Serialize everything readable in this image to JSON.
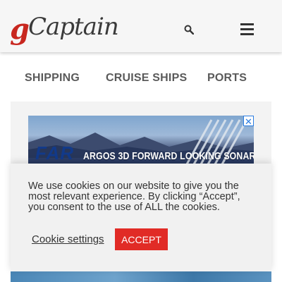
{
  "header": {
    "logo": {
      "initial": "g",
      "rest": "Captain"
    },
    "search_icon": "search-icon",
    "menu_icon": "hamburger-menu-icon"
  },
  "nav": {
    "items": [
      {
        "label": "SHIPPING"
      },
      {
        "label": "CRUISE SHIPS"
      },
      {
        "label": "PORTS"
      }
    ]
  },
  "ad": {
    "brand": "FAR",
    "text": "ARGOS 3D FORWARD LOOKING SONAR",
    "close_icon": "ad-close-icon"
  },
  "cookie": {
    "message": "We use cookies on our website to give you the most relevant experience. By clicking “Accept”, you consent to the use of ALL the cookies.",
    "settings_label": "Cookie settings",
    "accept_label": "ACCEPT"
  },
  "colors": {
    "brand_red": "#e12b26",
    "header_bg": "#f6f6f6",
    "nav_text": "#5a5a5a"
  }
}
